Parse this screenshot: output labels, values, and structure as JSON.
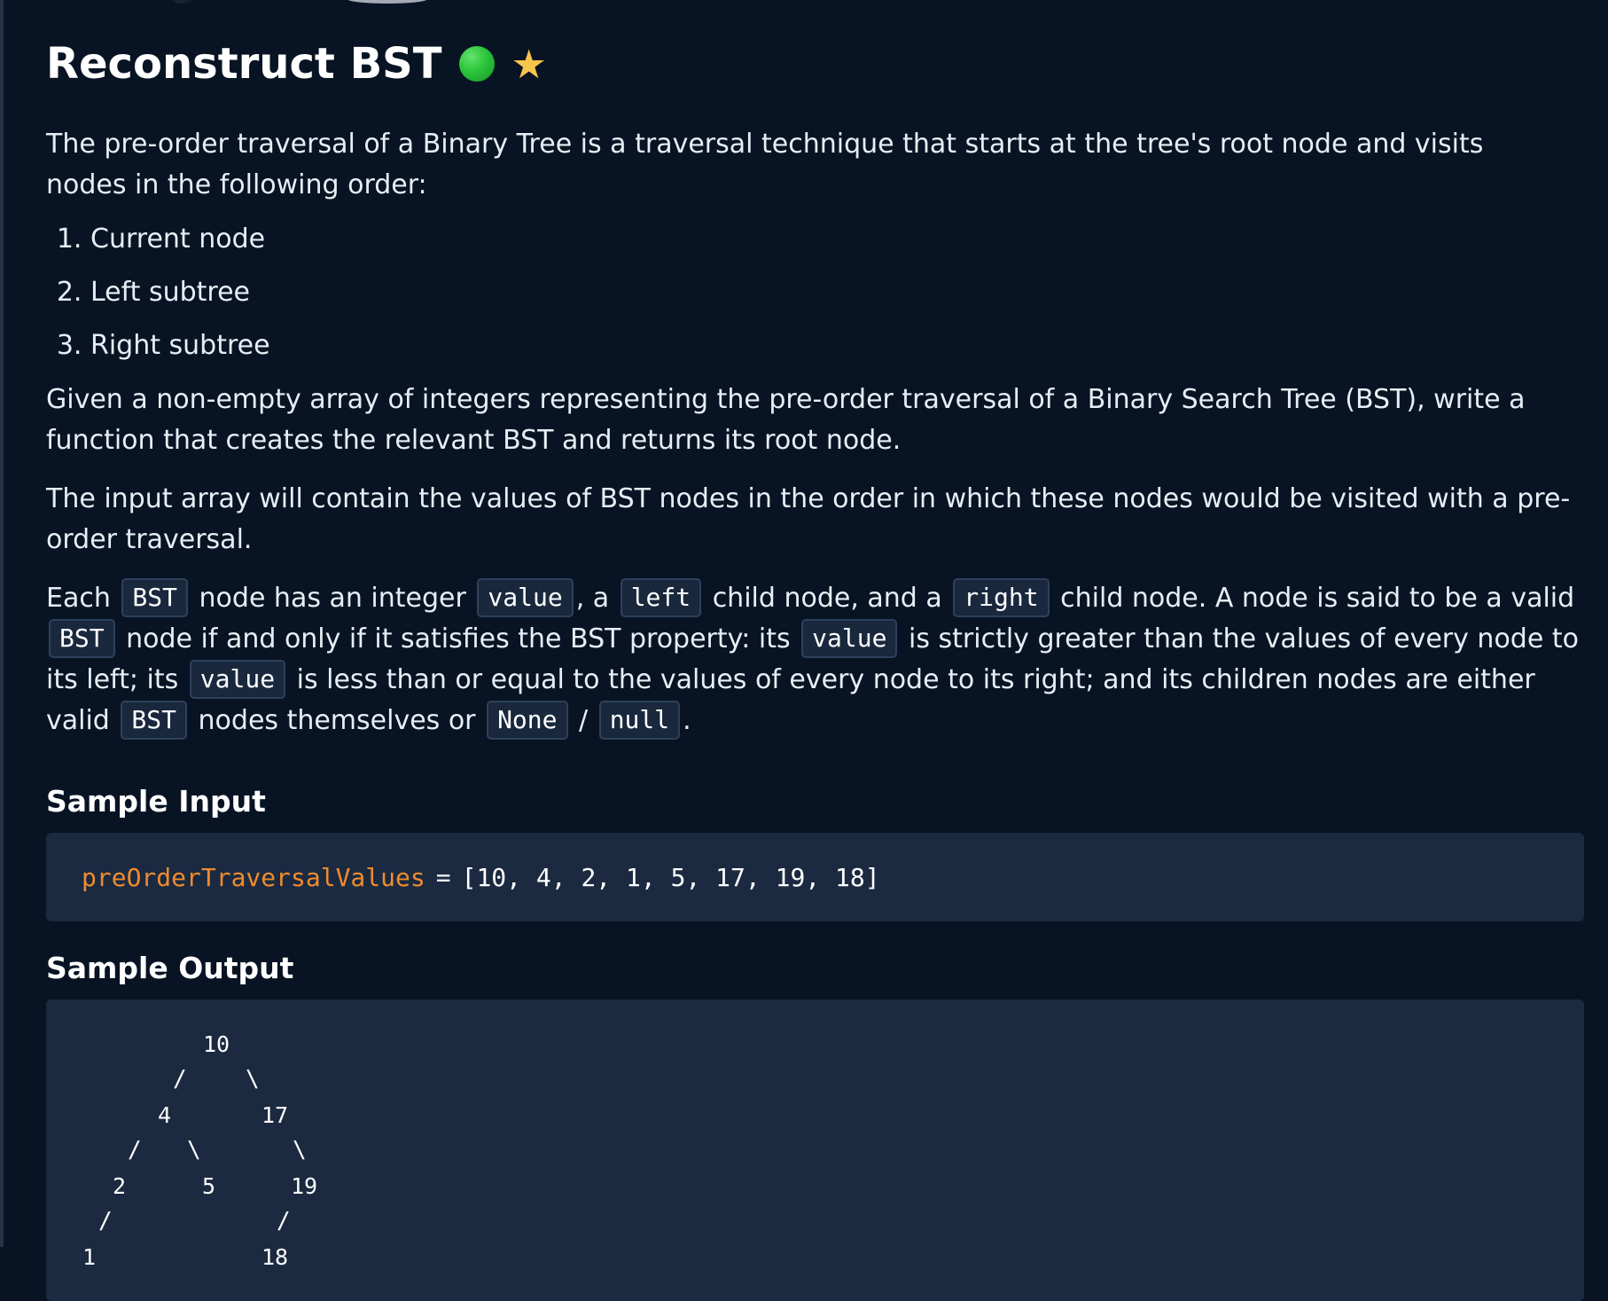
{
  "problem": {
    "title": "Reconstruct BST",
    "difficulty_icon": "green-circle",
    "favorite_icon": "star",
    "intro": "The pre-order traversal of a Binary Tree is a traversal technique that starts at the tree's root node and visits nodes in the following order:",
    "order_items": [
      "Current node",
      "Left subtree",
      "Right subtree"
    ],
    "paragraph_1": "Given a non-empty array of integers representing the pre-order traversal of a Binary Search Tree (BST), write a function that creates the relevant BST and returns its root node.",
    "paragraph_2": "The input array will contain the values of BST nodes in the order in which these nodes would be visited with a pre-order traversal.",
    "paragraph_3": {
      "each": "Each",
      "node_has": "node has an integer",
      "comma_a": ", a",
      "child_node_and": "child node, and a",
      "child_node_valid": "child node. A node is said to be a valid",
      "node_if": "node if and only if it satisfies the BST property: its",
      "greater": "is strictly greater than the values of every node to its left; its",
      "less": "is less than or equal to the values of every node to its right; and its children nodes are either valid",
      "nodes_or": "nodes themselves or",
      "slash": "/",
      "period": "."
    },
    "code_terms": {
      "bst": "BST",
      "value": "value",
      "left": "left",
      "right": "right",
      "none": "None",
      "null": "null"
    }
  },
  "sample_input": {
    "title": "Sample Input",
    "variable": "preOrderTraversalValues",
    "operator": "=",
    "array": "[10, 4, 2, 1, 5, 17, 19, 18]"
  },
  "sample_output": {
    "title": "Sample Output",
    "nodes": [
      "10",
      "4",
      "17",
      "2",
      "5",
      "19",
      "1",
      "18"
    ],
    "edge_slash": "/",
    "edge_backslash": "\\"
  },
  "colors": {
    "background": "#081423",
    "code_background": "#1b2a40",
    "accent_orange": "#f08b2f",
    "difficulty_green": "#2bc43a",
    "star_yellow": "#f6c54d"
  }
}
